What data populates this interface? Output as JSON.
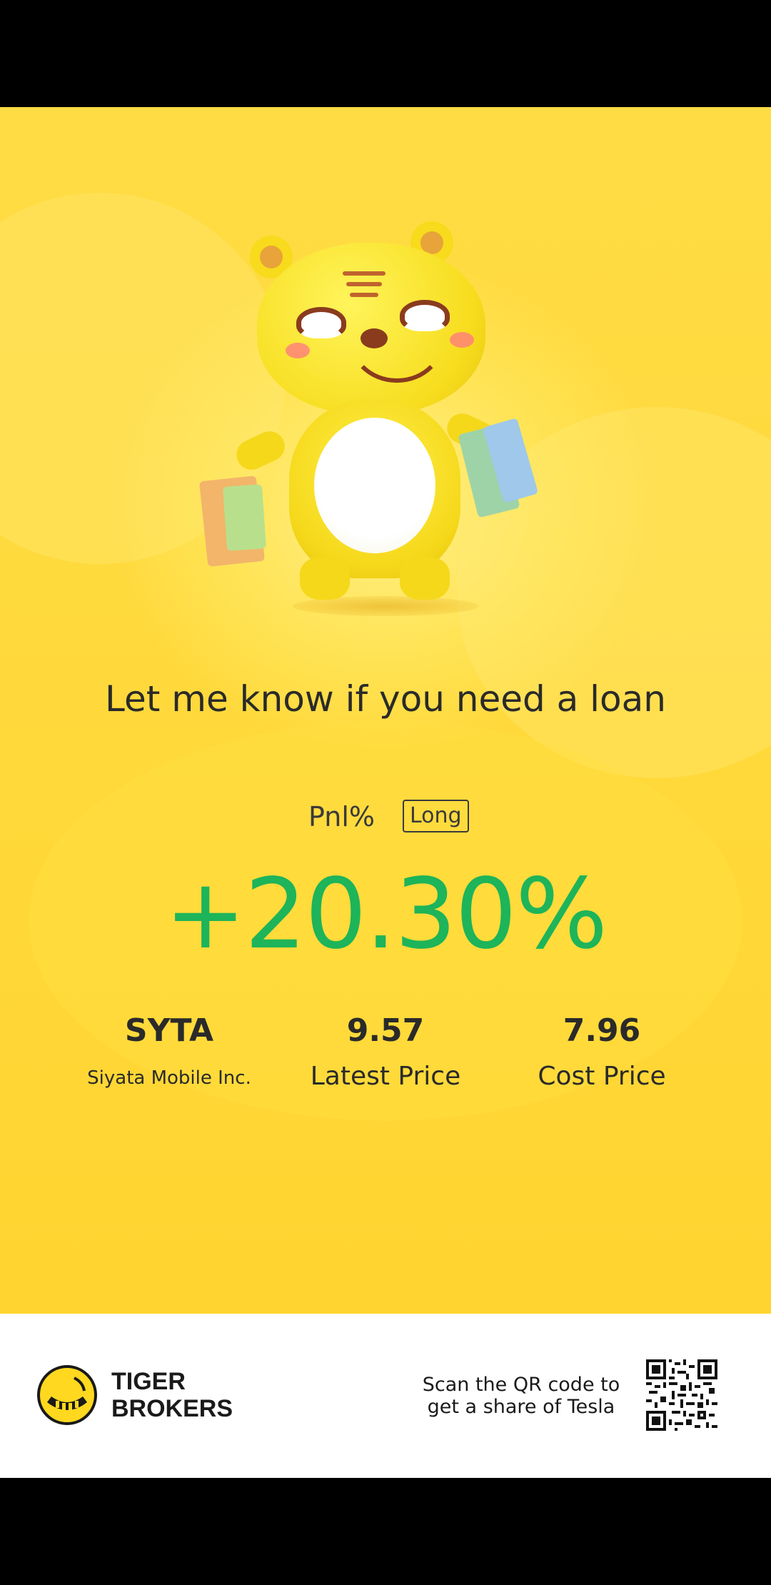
{
  "card": {
    "headline": "Let me know if you need a loan",
    "pnl_label": "Pnl%",
    "position_badge": "Long",
    "pnl_value": "+20.30%",
    "pnl_color": "#1DB45A",
    "background_color": "#FFD93B"
  },
  "stats": {
    "symbol": "SYTA",
    "company_name": "Siyata Mobile Inc.",
    "latest_price": "9.57",
    "latest_price_label": "Latest Price",
    "cost_price": "7.96",
    "cost_price_label": "Cost Price"
  },
  "footer": {
    "logo_line1": "TIGER",
    "logo_line2": "BROKERS",
    "scan_line1": "Scan the QR code to",
    "scan_line2": "get a share of Tesla",
    "qr_icon": "qr-code-icon"
  }
}
